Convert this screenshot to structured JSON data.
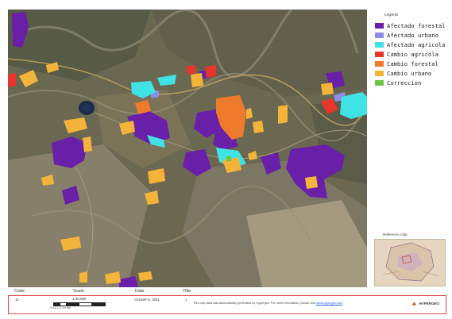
{
  "legend": {
    "title": "Legend",
    "items": [
      {
        "label": "Afectado forestal",
        "color": "#6a1fa8"
      },
      {
        "label": "Afectado urbano",
        "color": "#8a8ee6"
      },
      {
        "label": "Afectado agricola",
        "color": "#3fe3e6"
      },
      {
        "label": "Cambio agricola",
        "color": "#e8352a"
      },
      {
        "label": "Cambio forestal",
        "color": "#ee7b2b"
      },
      {
        "label": "Cambio urbano",
        "color": "#f4b43a"
      },
      {
        "label": "Correccion",
        "color": "#6fc24a"
      }
    ]
  },
  "reference_map": {
    "title": "Reference map"
  },
  "footer": {
    "code_header": "Code",
    "scale_header": "Scale",
    "date_header": "Date",
    "title_header": "Title",
    "code_value": "11",
    "scale_value": "1:30,000",
    "scale_ticks": "0    0.5    1         2         3    4 km",
    "date_value": "October 6, 2011",
    "title_value": "1",
    "note_text": "This map data was automatically generated by Hypergeo. For more information, please visit",
    "note_link": "www.hypergeo.com",
    "logo_text": "HYPERGEO"
  },
  "map": {
    "basemap": "satellite-imagery",
    "features": "land-change-polygons"
  }
}
